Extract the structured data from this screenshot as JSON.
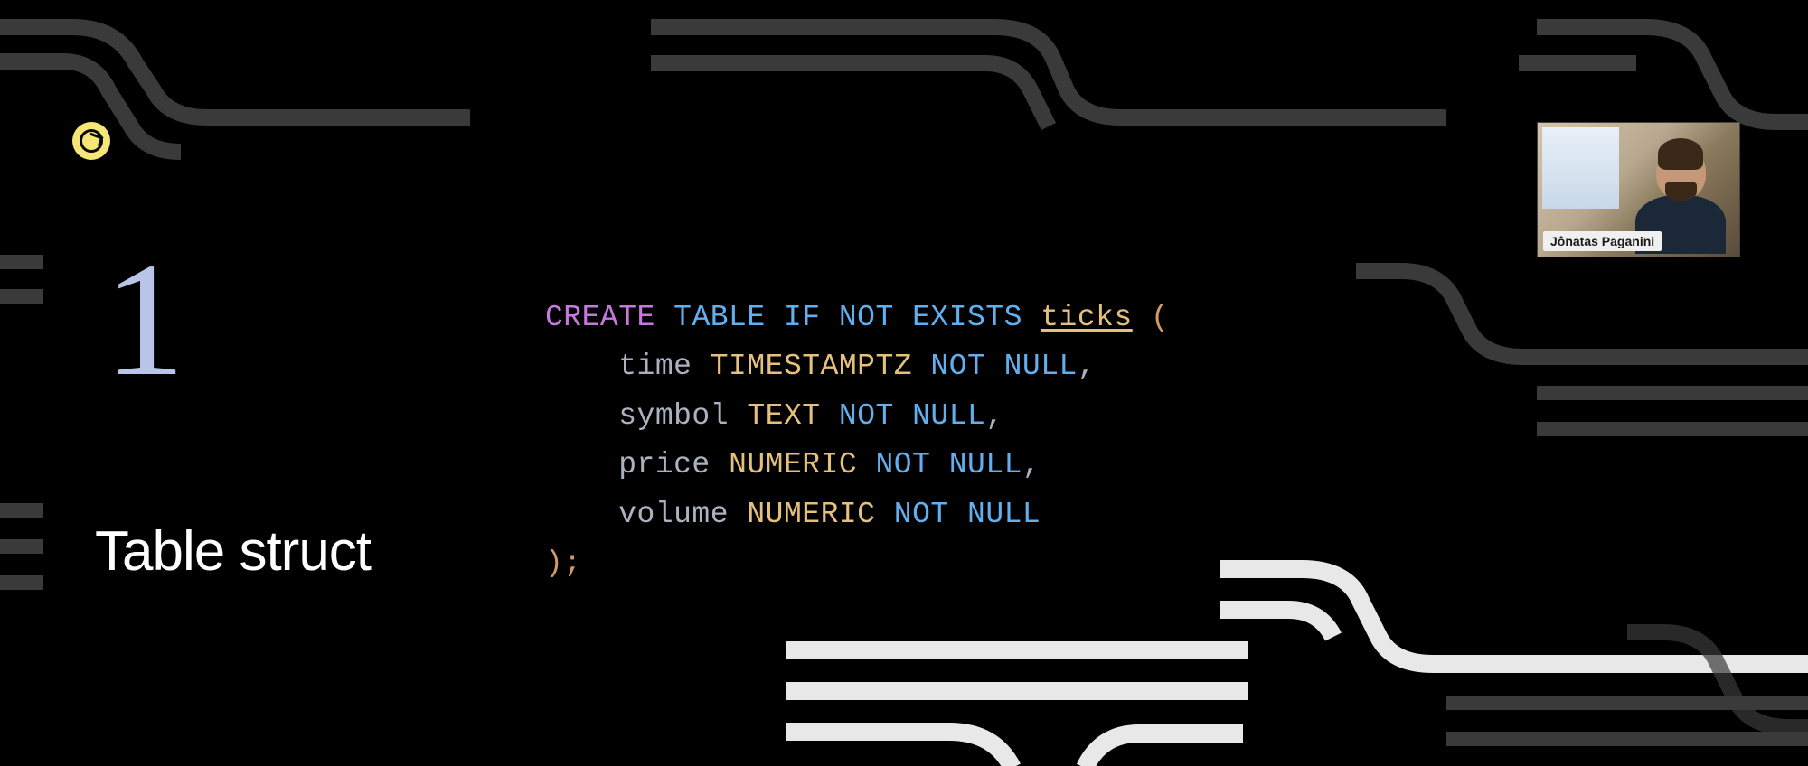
{
  "slide": {
    "number": "1",
    "title": "Table struct"
  },
  "code": {
    "line1": {
      "create": "CREATE",
      "tableIfNotExists": "TABLE IF NOT EXISTS",
      "tableName": "ticks",
      "openParen": " ("
    },
    "line2": {
      "col": "time",
      "type": "TIMESTAMPTZ",
      "constraint": "NOT NULL",
      "comma": ","
    },
    "line3": {
      "col": "symbol",
      "type": "TEXT",
      "constraint": "NOT NULL",
      "comma": ","
    },
    "line4": {
      "col": "price",
      "type": "NUMERIC",
      "constraint": "NOT NULL",
      "comma": ","
    },
    "line5": {
      "col": "volume",
      "type": "NUMERIC",
      "constraint": "NOT NULL"
    },
    "line6": {
      "close": ");"
    }
  },
  "webcam": {
    "presenterName": "Jônatas Paganini"
  }
}
